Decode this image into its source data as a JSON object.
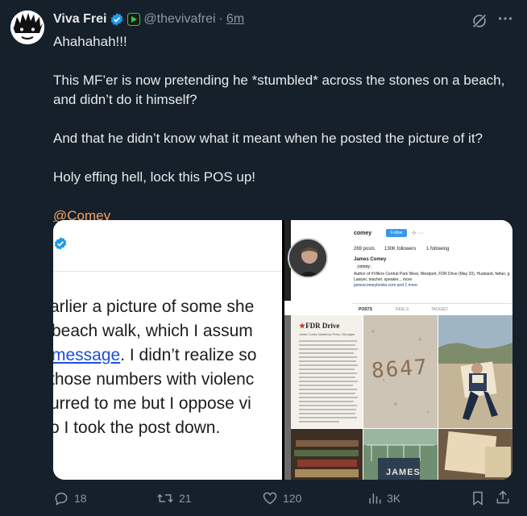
{
  "tweet": {
    "author_name": "Viva Frei",
    "handle": "@thevivafrei",
    "separator": "·",
    "time": "6m",
    "paragraphs": [
      "Ahahahah!!!",
      "This MF’er is now pretending he *stumbled* across the stones on a beach, and didn’t do it himself?",
      "And that he didn’t know what it meant when he posted the picture of it?",
      "Holy effing hell, lock this POS up!"
    ],
    "mention": "@Comey"
  },
  "media": {
    "left_lines": [
      "arlier a picture of some she",
      "beach walk, which I assum",
      "message",
      ". I didn’t realize so",
      "those numbers with violenc",
      "urred to me but I oppose vi",
      "o I took the post down."
    ],
    "instagram": {
      "username": "comey",
      "follow_label": "Follow",
      "posts": "269 posts",
      "followers": "130K followers",
      "following": "1 following",
      "full_name": "James Comey",
      "threads_tag": "comey",
      "bio": "Author of #Villers Central Park West, Westport, FDR Drive (May 20), Husband, father, g",
      "bio2": "Lawyer, teacher, speaker... more",
      "link": "jamescomeybooks.com and 1 more",
      "tabs": [
        "POSTS",
        "REELS",
        "TAGGED"
      ],
      "book_title": "FDR Drive",
      "book_sub": "James Comey, Mysterious Press, 336 pages",
      "sand_text": "8647",
      "book_spine": "JAMES"
    }
  },
  "actions": {
    "replies": "18",
    "reposts": "21",
    "likes": "120",
    "views": "3K"
  },
  "colors": {
    "background": "#15202b",
    "text": "#e7e9ea",
    "muted": "#8b98a5",
    "verified": "#1d9bf0",
    "mention": "#f4a261"
  }
}
